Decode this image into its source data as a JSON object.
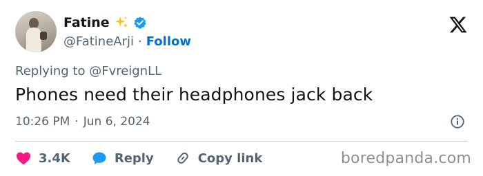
{
  "author": {
    "display_name": "Fatine",
    "handle": "@FatineArji",
    "follow_label": "Follow",
    "separator": "·"
  },
  "tweet": {
    "reply_prefix": "Replying to",
    "reply_handle": "@FvreignLL",
    "text": "Phones need their headphones jack back",
    "time": "10:26 PM",
    "date": "Jun 6, 2024",
    "separator": "·"
  },
  "actions": {
    "like_count": "3.4K",
    "reply_label": "Reply",
    "copy_link_label": "Copy link"
  },
  "watermark": "boredpanda.com",
  "icons": {
    "brand": "x-logo-icon",
    "badge": "verified-badge-icon",
    "emoji": "sparkles-icon",
    "info": "info-icon",
    "like": "heart-icon",
    "reply": "speech-bubble-icon",
    "copy": "link-icon"
  },
  "colors": {
    "text": "#0f1419",
    "secondary": "#536471",
    "link": "#006fd6",
    "verified": "#1d9bf0",
    "heart": "#f91880",
    "sparkle": "#f5c21b",
    "divider": "#cfd9de"
  }
}
